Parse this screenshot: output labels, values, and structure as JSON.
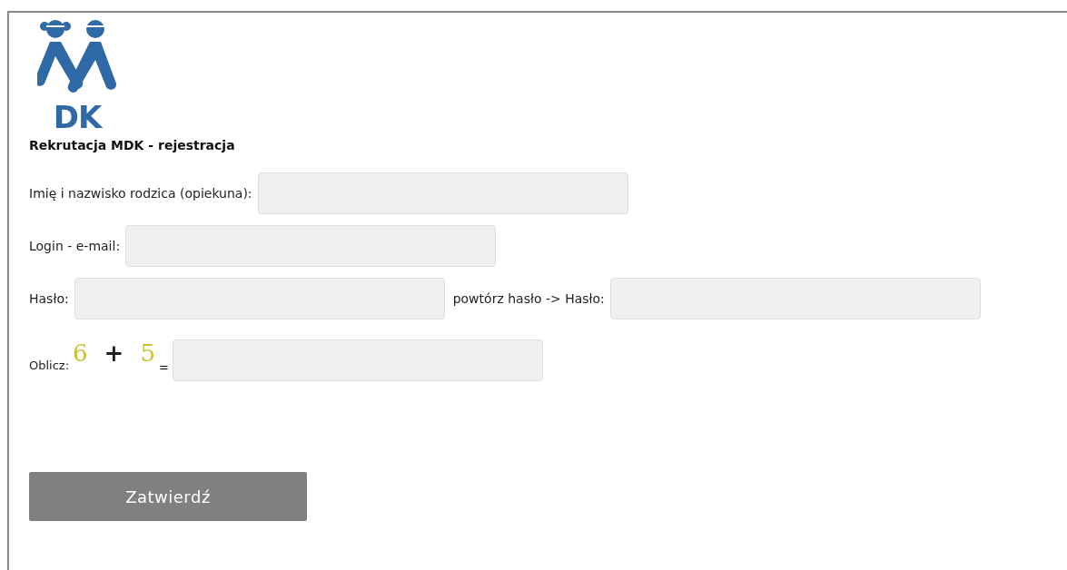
{
  "logo": {
    "text": "DK"
  },
  "title": "Rekrutacja MDK - rejestracja",
  "rows": [
    {
      "fields": [
        {
          "label": "Imię i nazwisko rodzica (opiekuna):"
        }
      ]
    },
    {
      "fields": [
        {
          "label": "Login - e-mail:"
        }
      ]
    },
    {
      "fields": [
        {
          "label": "Hasło:"
        },
        {
          "label": "powtórz hasło -> Hasło:"
        }
      ]
    }
  ],
  "captcha": {
    "label": "Oblicz:",
    "operand_1": "6",
    "operator": "+",
    "operand_2": "5",
    "equals": "="
  },
  "submit": {
    "label": "Zatwierdź"
  }
}
